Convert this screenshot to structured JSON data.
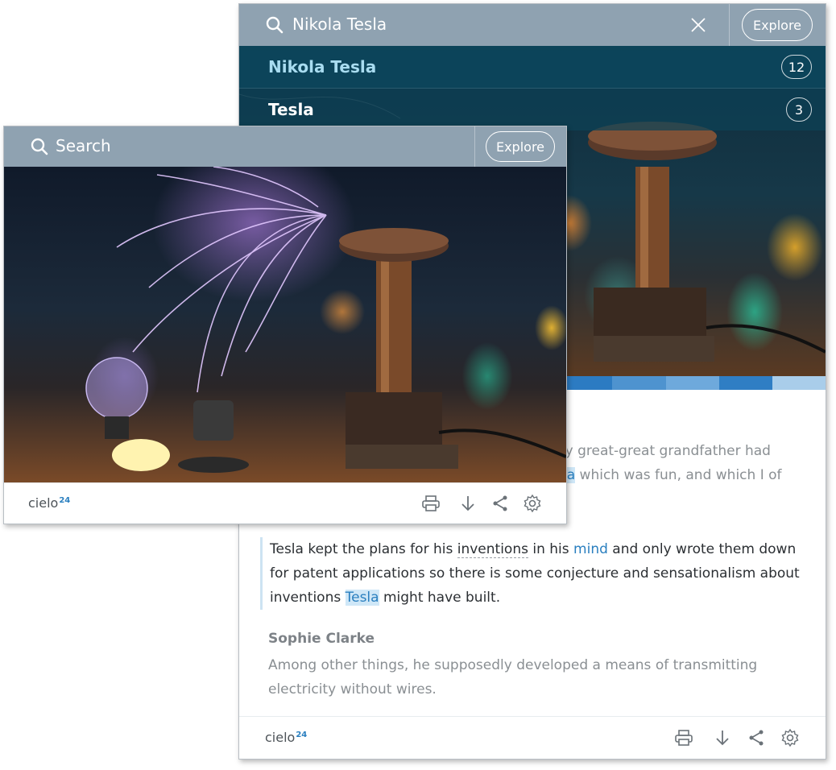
{
  "back_panel": {
    "search": {
      "query": "Nikola Tesla",
      "explore_label": "Explore"
    },
    "suggestions": [
      {
        "label": "Nikola Tesla",
        "count": "12",
        "color": "#a9dcf0"
      },
      {
        "label": "Tesla",
        "count": "3",
        "color": "#ffffff"
      }
    ],
    "colorbar": [
      "#5fa0d8",
      "#6aa8dc",
      "#4f95d2",
      "#8fbfe6",
      "#3a86c8",
      "#5b9fd7",
      "#2c7bc2",
      "#4e93cf",
      "#6ea9dc",
      "#2f7ec4",
      "#a9cdea"
    ],
    "transcript": {
      "line1": "t my great-great grandfather had",
      "line2_hl": "la",
      "line2_rest": " which was fun, and which I of",
      "quote": {
        "p1": "Tesla kept the plans for his ",
        "inventions": "inventions",
        "p2": " in his ",
        "mind": "mind",
        "p3": " and only wrote them down for patent applications so there is some conjecture and sensationalism about inventions ",
        "tesla": "Tesla",
        "p4": " might have built."
      },
      "speaker": "Sophie Clarke",
      "speaker_text": "Among other things, he supposedly developed a means of transmitting electricity without wires."
    },
    "footer": {
      "logo_text": "cielo",
      "logo_sup": "24"
    }
  },
  "front_panel": {
    "search": {
      "placeholder": "Search",
      "explore_label": "Explore"
    },
    "footer": {
      "logo_text": "cielo",
      "logo_sup": "24"
    }
  },
  "colors": {
    "searchbar": "#8fa2b1",
    "link": "#2a7fbf",
    "highlight": "#cfe7f7"
  }
}
